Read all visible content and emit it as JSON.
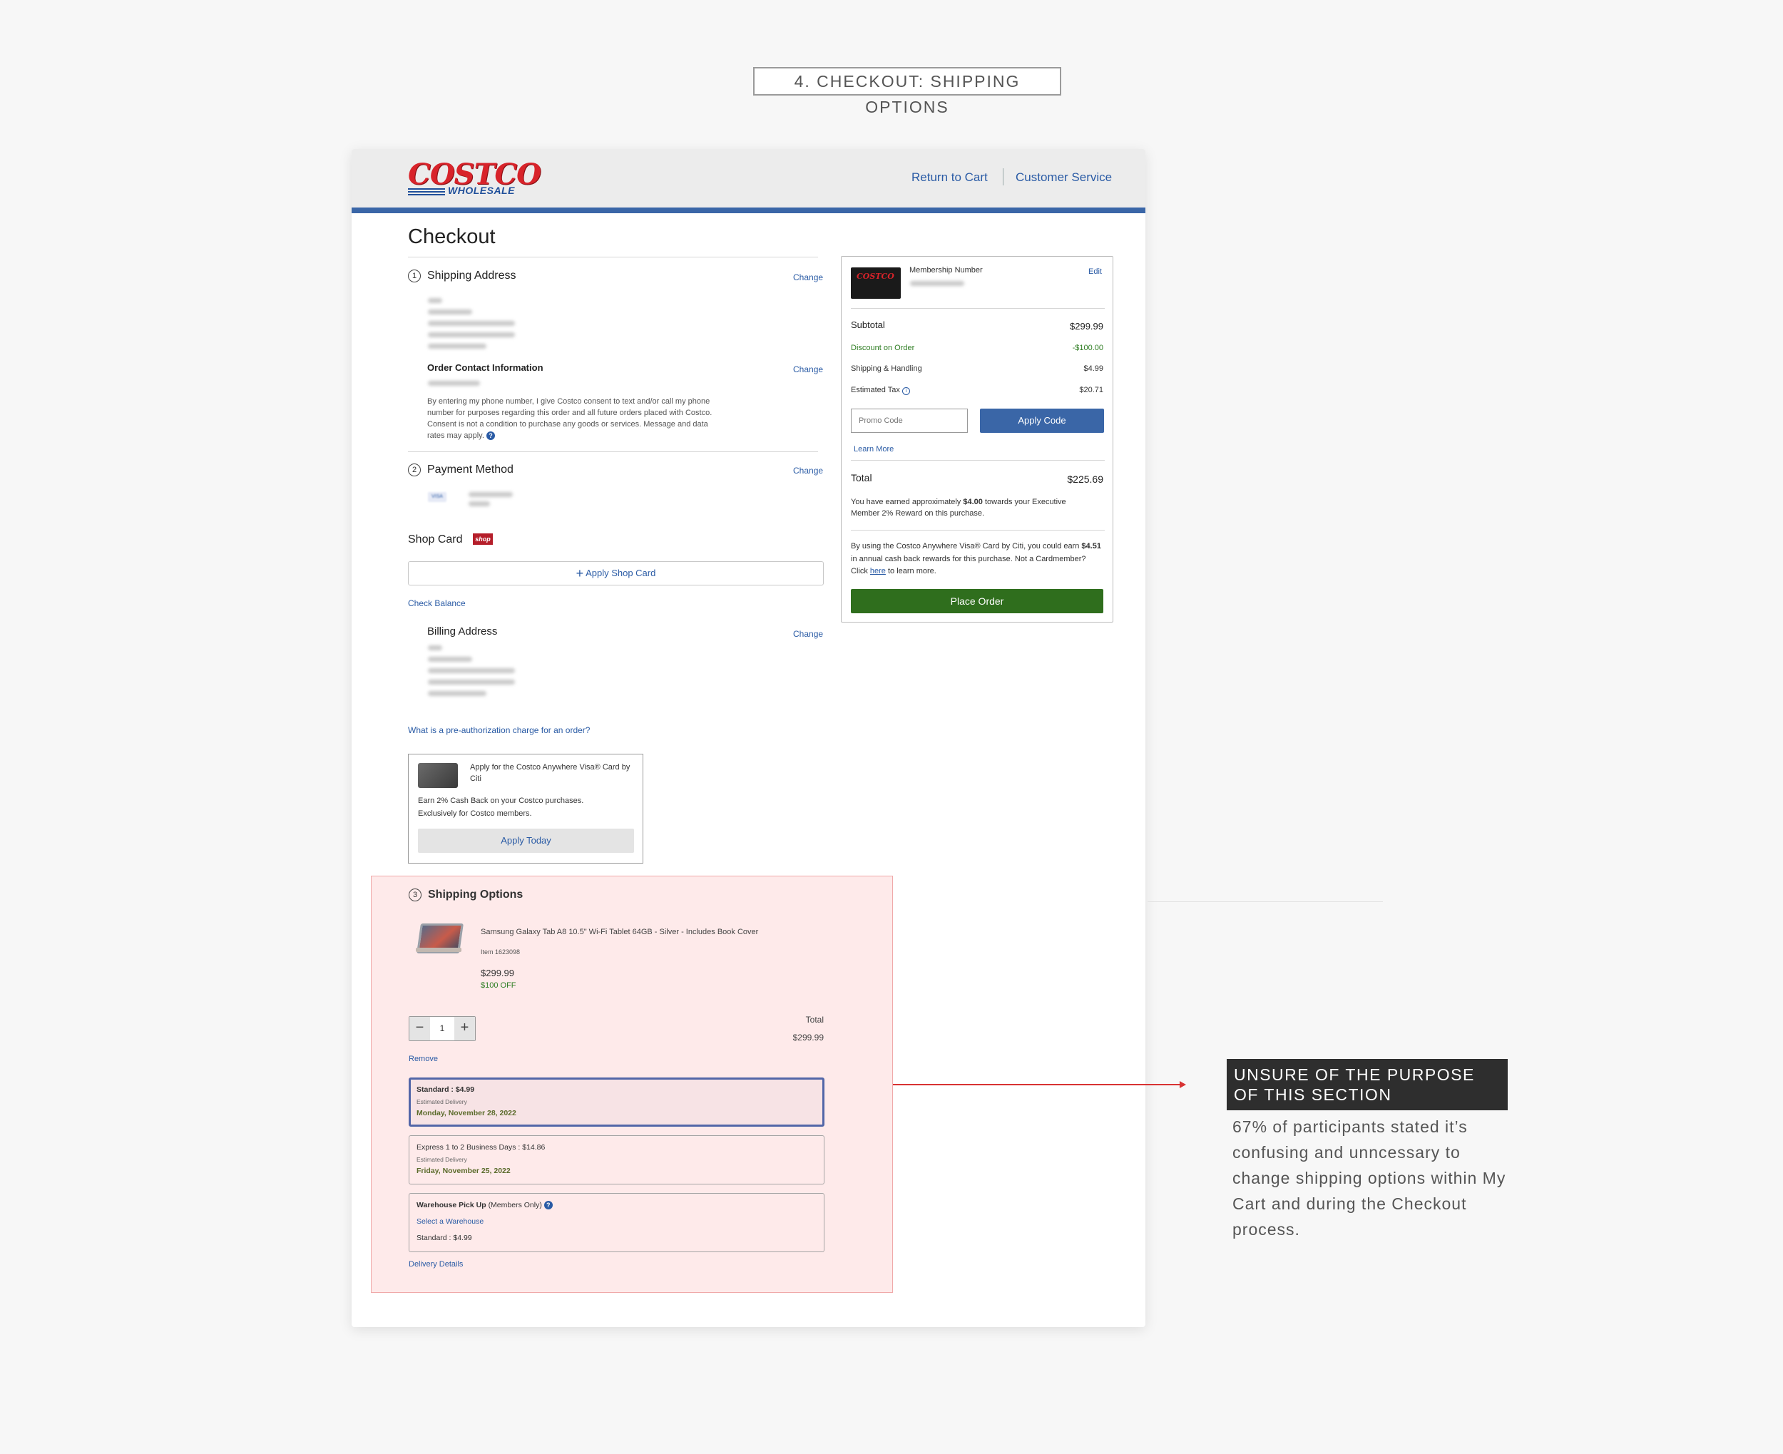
{
  "page_label": "4. CHECKOUT: SHIPPING OPTIONS",
  "header": {
    "logo_top": "COSTCO",
    "logo_bottom": "WHOLESALE",
    "return_to_cart": "Return to Cart",
    "customer_service": "Customer Service"
  },
  "checkout": {
    "title": "Checkout",
    "shipping_address": {
      "number": "1",
      "title": "Shipping Address",
      "change": "Change"
    },
    "order_contact": {
      "title": "Order Contact Information",
      "change": "Change",
      "consent": "By entering my phone number, I give Costco consent to text and/or call my phone number for purposes regarding this order and all future orders placed with Costco. Consent is not a condition to purchase any goods or services. Message and data rates may apply."
    },
    "payment": {
      "number": "2",
      "title": "Payment Method",
      "change": "Change",
      "card_brand": "VISA"
    },
    "shop_card": {
      "title": "Shop Card",
      "badge": "shop",
      "apply_label": "Apply Shop Card",
      "check_balance": "Check Balance"
    },
    "billing": {
      "title": "Billing Address",
      "change": "Change"
    },
    "preauth_link": "What is a pre-authorization charge for an order?",
    "citi_promo": {
      "heading": "Apply for the Costco Anywhere Visa® Card by Citi",
      "line1": "Earn 2% Cash Back on your Costco purchases.",
      "line2": "Exclusively for Costco members.",
      "button": "Apply Today"
    }
  },
  "summary": {
    "membership_label": "Membership Number",
    "edit": "Edit",
    "subtotal_label": "Subtotal",
    "subtotal": "$299.99",
    "discount_label": "Discount on Order",
    "discount": "-$100.00",
    "shipping_label": "Shipping & Handling",
    "shipping": "$4.99",
    "tax_label": "Estimated Tax",
    "tax": "$20.71",
    "promo_placeholder": "Promo Code",
    "apply_code": "Apply Code",
    "learn_more": "Learn More",
    "total_label": "Total",
    "total": "$225.69",
    "reward_pre": "You have earned approximately ",
    "reward_amount": "$4.00",
    "reward_post": " towards your Executive Member 2% Reward on this purchase.",
    "citi_pre": "By using the Costco Anywhere Visa® Card by Citi, you could earn ",
    "citi_amount": "$4.51",
    "citi_mid": " in annual cash back rewards for this purchase. Not a Cardmember? Click ",
    "citi_here": "here",
    "citi_post": " to learn more.",
    "place_order": "Place Order"
  },
  "shipping_options": {
    "number": "3",
    "title": "Shipping Options",
    "product_name": "Samsung Galaxy Tab A8 10.5\" Wi-Fi Tablet 64GB - Silver - Includes Book Cover",
    "item": "Item 1623098",
    "price": "$299.99",
    "off": "$100 OFF",
    "quantity": "1",
    "total_label": "Total",
    "total": "$299.99",
    "remove": "Remove",
    "options": [
      {
        "label": "Standard : $4.99",
        "est": "Estimated Delivery",
        "date": "Monday, November 28, 2022",
        "selected": true
      },
      {
        "label": "Express 1 to 2 Business Days : $14.86",
        "est": "Estimated Delivery",
        "date": "Friday, November 25, 2022",
        "selected": false
      }
    ],
    "warehouse": {
      "title": "Warehouse Pick Up",
      "members": "(Members Only)",
      "select": "Select a Warehouse",
      "standard": "Standard : $4.99"
    },
    "delivery_details": "Delivery Details"
  },
  "annotation": {
    "title": "UNSURE OF THE PURPOSE OF THIS SECTION",
    "body": "67% of participants stated it’s confusing and unncessary to change shipping options within My Cart and during the Checkout process."
  },
  "colors": {
    "accent": "#3a66a7",
    "place_order": "#2f6e1d",
    "brand_red": "#d8232a",
    "highlight": "#feeaea",
    "arrow": "#d83333"
  }
}
